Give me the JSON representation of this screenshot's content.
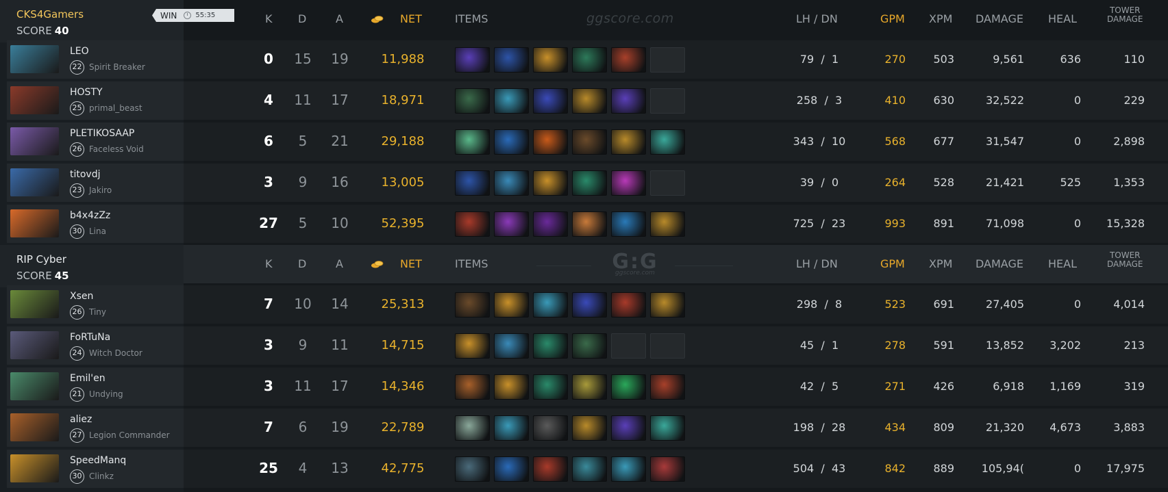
{
  "headers": {
    "k": "K",
    "d": "D",
    "a": "A",
    "net": "NET",
    "items": "ITEMS",
    "lhdn": "LH  /  DN",
    "gpm": "GPM",
    "xpm": "XPM",
    "damage": "DAMAGE",
    "heal": "HEAL",
    "tower_line1": "TOWER",
    "tower_line2": "DAMAGE"
  },
  "watermark_top": "ggscore.com",
  "watermark_logo": {
    "big": "G:G",
    "small": "ggscore.com"
  },
  "teams": [
    {
      "name": "CKS4Gamers",
      "score_label": "SCORE",
      "score": "40",
      "result": "WIN",
      "duration": "55:35",
      "players": [
        {
          "name": "LEO",
          "level": "22",
          "hero": "Spirit Breaker",
          "k": "0",
          "d": "15",
          "a": "19",
          "net": "11,988",
          "lh": "79",
          "dn": "1",
          "gpm": "270",
          "xpm": "503",
          "damage": "9,561",
          "heal": "636",
          "tower": "110",
          "portrait": "#3a7e9a",
          "items": [
            "#5a3fb8",
            "#2d54a8",
            "#c8902a",
            "#2d7a5a",
            "#a8402a",
            "empty"
          ]
        },
        {
          "name": "HOSTY",
          "level": "25",
          "hero": "primal_beast",
          "k": "4",
          "d": "11",
          "a": "17",
          "net": "18,971",
          "lh": "258",
          "dn": "3",
          "gpm": "410",
          "xpm": "630",
          "damage": "32,522",
          "heal": "0",
          "tower": "229",
          "portrait": "#8a3a2a",
          "items": [
            "#3a6a4a",
            "#3a9ab8",
            "#3a4ab8",
            "#b88a2a",
            "#5a3fb8",
            "empty"
          ]
        },
        {
          "name": "PLETIKOSAAP",
          "level": "26",
          "hero": "Faceless Void",
          "k": "6",
          "d": "5",
          "a": "21",
          "net": "29,188",
          "lh": "343",
          "dn": "10",
          "gpm": "568",
          "xpm": "677",
          "damage": "31,547",
          "heal": "0",
          "tower": "2,898",
          "portrait": "#7a5aa8",
          "items": [
            "#5ab88a",
            "#2a6ab8",
            "#c85a1a",
            "#6a4a2a",
            "#b88a2a",
            "#3aa89a"
          ]
        },
        {
          "name": "titovdj",
          "level": "23",
          "hero": "Jakiro",
          "k": "3",
          "d": "9",
          "a": "16",
          "net": "13,005",
          "lh": "39",
          "dn": "0",
          "gpm": "264",
          "xpm": "528",
          "damage": "21,421",
          "heal": "525",
          "tower": "1,353",
          "portrait": "#3a6aa8",
          "items": [
            "#2d54a8",
            "#3a8ab8",
            "#c8902a",
            "#2a8a6a",
            "#b83ab8",
            "empty"
          ]
        },
        {
          "name": "b4x4zZz",
          "level": "30",
          "hero": "Lina",
          "k": "27",
          "d": "5",
          "a": "10",
          "net": "52,395",
          "lh": "725",
          "dn": "23",
          "gpm": "993",
          "xpm": "891",
          "damage": "71,098",
          "heal": "0",
          "tower": "15,328",
          "portrait": "#d86a2a",
          "items": [
            "#a83a2a",
            "#8a3ab8",
            "#6a2a9a",
            "#c87a3a",
            "#2a7ab8",
            "#b88a2a"
          ]
        }
      ]
    },
    {
      "name": "RIP Cyber",
      "score_label": "SCORE",
      "score": "45",
      "players": [
        {
          "name": "Xsen",
          "level": "26",
          "hero": "Tiny",
          "k": "7",
          "d": "10",
          "a": "14",
          "net": "25,313",
          "lh": "298",
          "dn": "8",
          "gpm": "523",
          "xpm": "691",
          "damage": "27,405",
          "heal": "0",
          "tower": "4,014",
          "portrait": "#6a8a3a",
          "items": [
            "#6a4a2a",
            "#c8902a",
            "#3a9ab8",
            "#3a4ab8",
            "#a83a2a",
            "#b88a2a"
          ]
        },
        {
          "name": "FoRTuNa",
          "level": "24",
          "hero": "Witch Doctor",
          "k": "3",
          "d": "9",
          "a": "11",
          "net": "14,715",
          "lh": "45",
          "dn": "1",
          "gpm": "278",
          "xpm": "591",
          "damage": "13,852",
          "heal": "3,202",
          "tower": "213",
          "portrait": "#5a5a7a",
          "items": [
            "#c8902a",
            "#3a8ab8",
            "#2a8a6a",
            "#3a6a4a",
            "empty",
            "empty"
          ]
        },
        {
          "name": "Emil'en",
          "level": "21",
          "hero": "Undying",
          "k": "3",
          "d": "11",
          "a": "17",
          "net": "14,346",
          "lh": "42",
          "dn": "5",
          "gpm": "271",
          "xpm": "426",
          "damage": "6,918",
          "heal": "1,169",
          "tower": "319",
          "portrait": "#4a8a6a",
          "items": [
            "#a8602a",
            "#c8902a",
            "#2a8a6a",
            "#a89a3a",
            "#2aa85a",
            "#a8402a"
          ]
        },
        {
          "name": "aliez",
          "level": "27",
          "hero": "Legion Commander",
          "k": "7",
          "d": "6",
          "a": "19",
          "net": "22,789",
          "lh": "198",
          "dn": "28",
          "gpm": "434",
          "xpm": "809",
          "damage": "21,320",
          "heal": "4,673",
          "tower": "3,883",
          "portrait": "#a8602a",
          "items": [
            "#8aa89a",
            "#3a9ab8",
            "#5a5a5a",
            "#b88a2a",
            "#5a3fb8",
            "#3aa89a"
          ]
        },
        {
          "name": "SpeedManq",
          "level": "30",
          "hero": "Clinkz",
          "k": "25",
          "d": "4",
          "a": "13",
          "net": "42,775",
          "lh": "504",
          "dn": "43",
          "gpm": "842",
          "xpm": "889",
          "damage": "105,94(",
          "heal": "0",
          "tower": "17,975",
          "portrait": "#c8902a",
          "items": [
            "#4a6a7a",
            "#2a6ab8",
            "#a83a2a",
            "#3a8a9a",
            "#3a9ab8",
            "#a83a3a"
          ]
        }
      ]
    }
  ]
}
